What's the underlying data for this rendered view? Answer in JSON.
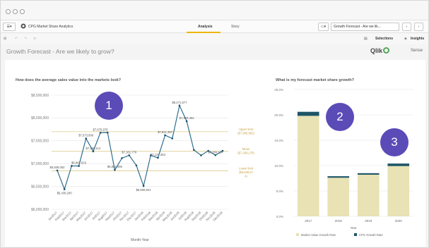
{
  "window": {
    "toolbar": {
      "app_name": "CPG Market Share Analytics",
      "tab_analysis": "Analysis",
      "tab_story": "Story",
      "sheet_selector": "Growth Forecast - Are we lik...",
      "selections": "Selections",
      "insights": "Insights"
    },
    "sheet": {
      "title": "Growth Forecast - Are we likely to grow?",
      "brand": "Qlik",
      "brand_suffix": "Sense"
    }
  },
  "colors": {
    "line": "#2f6f8f",
    "point": "#1d4f6b",
    "control_lines": "#d9c98a",
    "bar_main": "#e8e2b4",
    "bar_top": "#1d5567",
    "marker": "#5b4bb7"
  },
  "markers": [
    "1",
    "2",
    "3"
  ],
  "chart_data": [
    {
      "type": "line",
      "title": "How does the average sales value into the markets look?",
      "xlabel": "Month-Year",
      "y_ticks": [
        "$8,500,000",
        "$8,000,000",
        "$7,500,000",
        "$7,000,000",
        "$6,500,000",
        "$6,000,000"
      ],
      "ylim": [
        6000000,
        8500000
      ],
      "x": [
        "Jan2017",
        "Feb2017",
        "Mar2017",
        "Apr2017",
        "May2017",
        "Jun2017",
        "Jul2017",
        "Aug2017",
        "Sep2017",
        "Oct2017",
        "Nov2017",
        "Dec2017",
        "Jan2018",
        "Feb2018",
        "Mar2018",
        "Apr2018",
        "May2018",
        "Jun2018",
        "Jul2018",
        "Aug2018",
        "Sep2018",
        "Oct2018",
        "Nov2018",
        "Dec2018"
      ],
      "values": [
        6850000,
        6438280,
        6950000,
        6947816,
        7550000,
        7268114,
        7675878,
        7680000,
        6861459,
        7120000,
        7181779,
        6960000,
        6508941,
        7180000,
        7127353,
        7621357,
        7550000,
        8271577,
        7929462,
        7300000,
        7180000,
        7280000,
        7184124,
        7280000
      ],
      "point_labels": [
        {
          "index": 0,
          "text": "$6,838,052"
        },
        {
          "index": 1,
          "text": "$6,438,280"
        },
        {
          "index": 3,
          "text": "$6,947,816"
        },
        {
          "index": 4,
          "text": "$7,573,806"
        },
        {
          "index": 5,
          "text": "$7,268,114"
        },
        {
          "index": 6,
          "text": "$7,675,878"
        },
        {
          "index": 8,
          "text": "$6,861,459"
        },
        {
          "index": 10,
          "text": "$7,181,779"
        },
        {
          "index": 12,
          "text": "$6,508,941"
        },
        {
          "index": 14,
          "text": "$7,127,353"
        },
        {
          "index": 15,
          "text": "$7,621,357"
        },
        {
          "index": 17,
          "text": "$8,271,577"
        },
        {
          "index": 18,
          "text": "$7,929,462"
        },
        {
          "index": 22,
          "text": "$7,184,124"
        }
      ],
      "reference_lines": [
        {
          "name": "Upper limit",
          "value": 7700000,
          "label_1": "Upper limit",
          "label_2": "($7,698,982)"
        },
        {
          "name": "Mean",
          "value": 7268000,
          "label_1": "Mean",
          "label_2": "($7,268,278)"
        },
        {
          "name": "Lower limit",
          "value": 6840000,
          "label_1": "Lower limit",
          "label_2": "($6,838,57",
          "label_3": "4)"
        }
      ]
    },
    {
      "type": "bar",
      "title": "What is my forecast market share growth?",
      "xlabel": "Year",
      "categories": [
        "2017",
        "2018",
        "2019",
        "2020"
      ],
      "y_ticks": [
        "25.0%",
        "20.0%",
        "15.0%",
        "10.0%",
        "5.0%",
        "0.0%"
      ],
      "ylim": [
        0,
        25
      ],
      "series": [
        {
          "name": "Market Value Growth Rate",
          "values": [
            19.8,
            7.6,
            8.2,
            9.9
          ]
        },
        {
          "name": "CPG Growth Rate",
          "values": [
            0.8,
            0.3,
            0.3,
            0.5
          ]
        }
      ]
    }
  ]
}
